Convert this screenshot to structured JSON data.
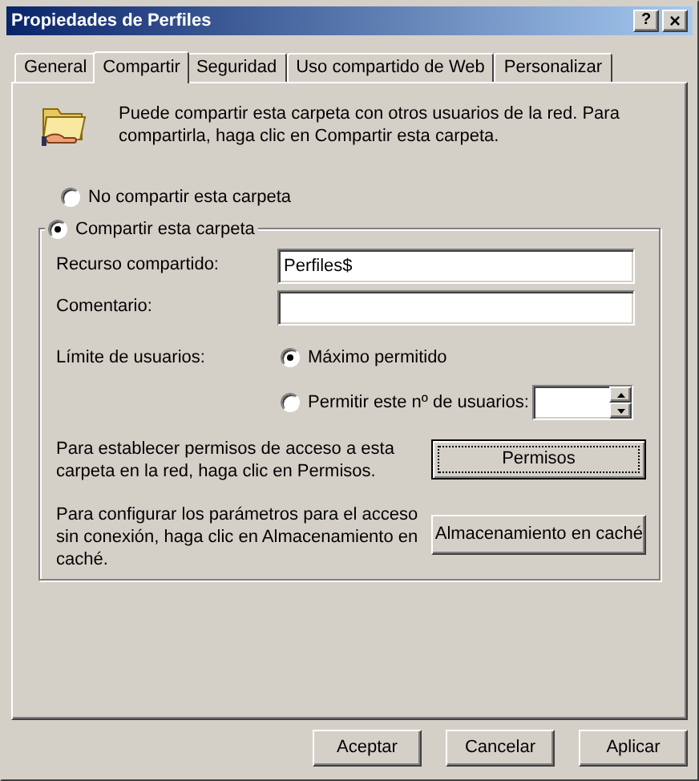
{
  "window": {
    "title": "Propiedades de Perfiles",
    "help_button": "?",
    "close_button": "×"
  },
  "tabs": [
    {
      "label": "General",
      "selected": false
    },
    {
      "label": "Compartir",
      "selected": true
    },
    {
      "label": "Seguridad",
      "selected": false
    },
    {
      "label": "Uso compartido de Web",
      "selected": false
    },
    {
      "label": "Personalizar",
      "selected": false
    }
  ],
  "intro": "Puede compartir esta carpeta con otros usuarios de la red. Para compartirla, haga clic en Compartir esta carpeta.",
  "share_options": [
    {
      "label": "No compartir esta carpeta",
      "selected": false
    },
    {
      "label": "Compartir esta carpeta",
      "selected": true
    }
  ],
  "share_name": {
    "label": "Recurso compartido:",
    "value": "Perfiles$"
  },
  "comment": {
    "label": "Comentario:"
  },
  "user_limit": {
    "label": "Límite de usuarios:",
    "options": [
      {
        "label": "Máximo permitido",
        "selected": true
      },
      {
        "label": "Permitir este nº de usuarios:",
        "selected": false
      }
    ]
  },
  "permissions": {
    "text": "Para establecer permisos de acceso a esta carpeta en la red, haga clic en Permisos.",
    "button": "Permisos"
  },
  "caching": {
    "text": "Para configurar los parámetros para el acceso sin conexión, haga clic en Almacenamiento en caché.",
    "button": "Almacenamiento en caché"
  },
  "buttons": [
    "Aceptar",
    "Cancelar",
    "Aplicar"
  ]
}
